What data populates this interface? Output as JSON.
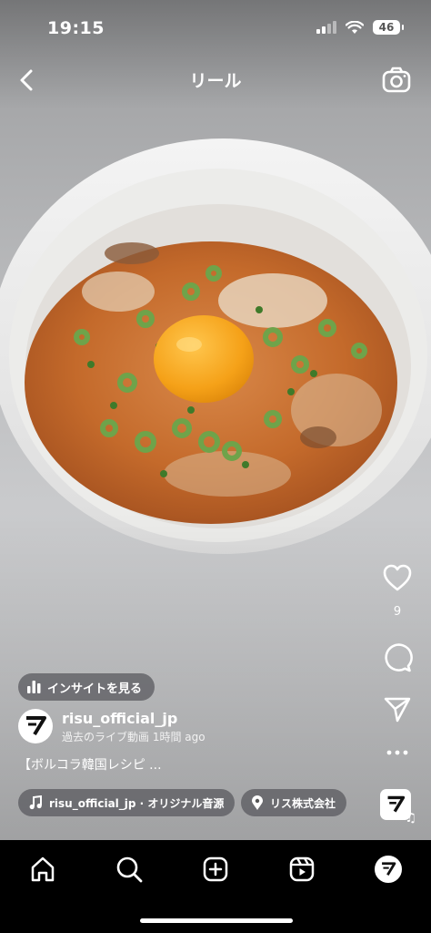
{
  "status_bar": {
    "time": "19:15",
    "battery": "46"
  },
  "header": {
    "title": "リール",
    "back_icon": "chevron-left-icon",
    "camera_icon": "camera-icon"
  },
  "actions": {
    "like_count": "9"
  },
  "insights": {
    "label": "インサイトを見る"
  },
  "post": {
    "username": "risu_official_jp",
    "subtitle": "過去のライブ動画 1時間 ago",
    "caption": "【ボルコラ韓国レシピ ...",
    "audio_label": "risu_official_jp · オリジナル音源",
    "location_label": "リス株式会社",
    "avatar_logo": "RISU"
  },
  "tabbar": {
    "items": [
      "home-icon",
      "search-icon",
      "create-icon",
      "reels-icon",
      "profile-avatar"
    ]
  }
}
